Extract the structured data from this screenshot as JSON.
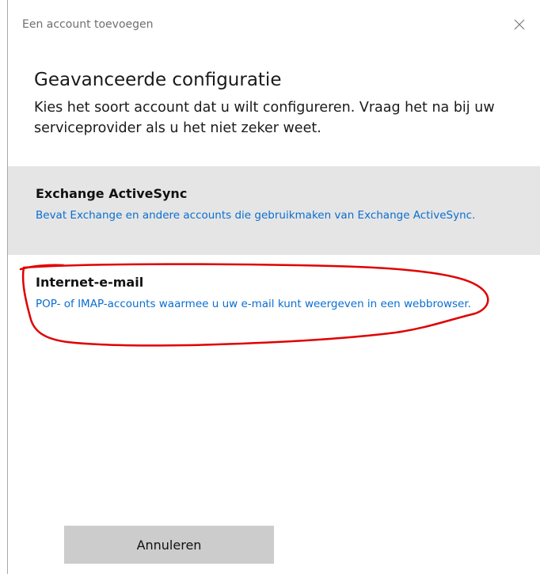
{
  "window": {
    "title": "Een account toevoegen"
  },
  "main": {
    "heading": "Geavanceerde configuratie",
    "description": "Kies het soort account dat u wilt configureren. Vraag het na bij uw serviceprovider als u het niet zeker weet."
  },
  "options": [
    {
      "title": "Exchange ActiveSync",
      "description": "Bevat Exchange en andere accounts die gebruikmaken van Exchange ActiveSync."
    },
    {
      "title": "Internet-e-mail",
      "description": "POP- of IMAP-accounts waarmee u uw e-mail kunt weergeven in een webbrowser."
    }
  ],
  "footer": {
    "cancel_label": "Annuleren"
  },
  "icons": {
    "close": "close-icon"
  },
  "colors": {
    "link_blue": "#0a6ed1",
    "selected_background": "#e5e5e5",
    "button_background": "#cccccc",
    "annotation_red": "#e00000"
  }
}
